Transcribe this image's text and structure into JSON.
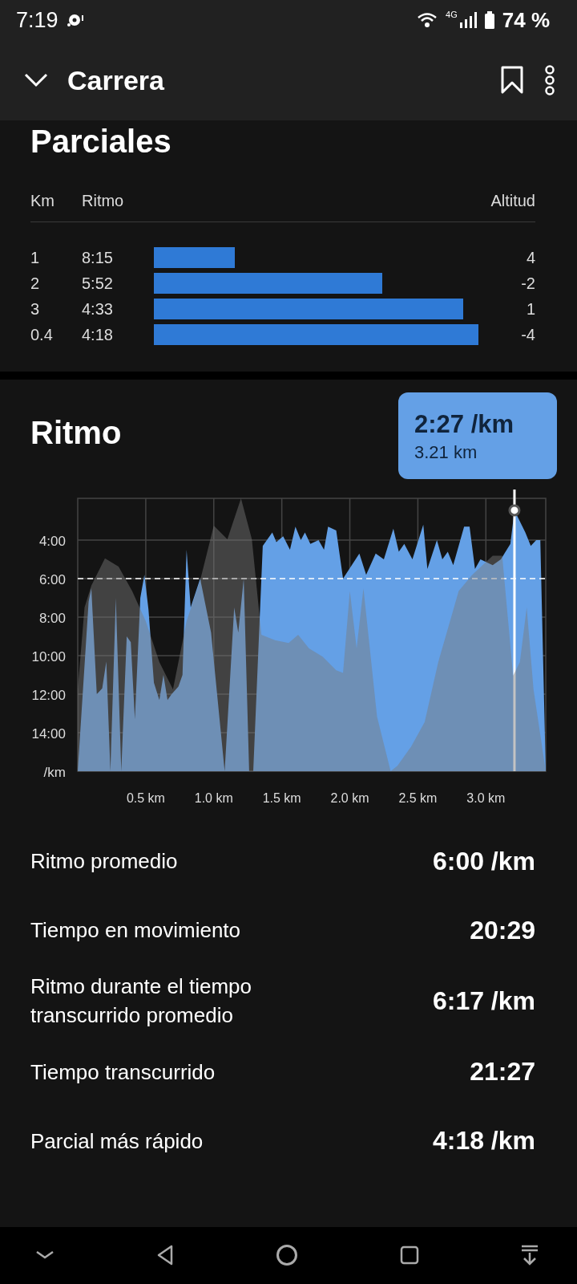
{
  "status_bar": {
    "time": "7:19",
    "network": "4G",
    "battery": "74 %"
  },
  "app_bar": {
    "title": "Carrera"
  },
  "splits": {
    "title": "Parciales",
    "columns": [
      "Km",
      "Ritmo",
      "Altitud"
    ],
    "rows": [
      {
        "km": "1",
        "pace": "8:15",
        "elevation": "4"
      },
      {
        "km": "2",
        "pace": "5:52",
        "elevation": "-2"
      },
      {
        "km": "3",
        "pace": "4:33",
        "elevation": "1"
      },
      {
        "km": "0.4",
        "pace": "4:18",
        "elevation": "-4"
      }
    ]
  },
  "pace": {
    "title": "Ritmo",
    "tooltip": {
      "value": "2:27 /km",
      "distance": "3.21 km"
    },
    "chart_data": {
      "type": "area",
      "grid": true,
      "xlim": [
        0,
        3.44
      ],
      "ylim": [
        16,
        1.83
      ],
      "x": [
        0,
        0.08,
        0.1,
        0.14,
        0.18,
        0.21,
        0.24,
        0.28,
        0.32,
        0.36,
        0.39,
        0.42,
        0.46,
        0.49,
        0.52,
        0.56,
        0.6,
        0.63,
        0.66,
        0.69,
        0.74,
        0.77,
        0.8,
        0.83,
        0.9,
        0.98,
        1.08,
        1.15,
        1.18,
        1.22,
        1.26,
        1.29,
        1.36,
        1.43,
        1.46,
        1.51,
        1.56,
        1.6,
        1.64,
        1.67,
        1.71,
        1.77,
        1.81,
        1.84,
        1.9,
        1.95,
        2.07,
        2.12,
        2.19,
        2.25,
        2.32,
        2.36,
        2.4,
        2.46,
        2.54,
        2.57,
        2.64,
        2.68,
        2.72,
        2.76,
        2.84,
        2.88,
        2.92,
        2.96,
        3.05,
        3.11,
        3.18,
        3.21,
        3.29,
        3.33,
        3.37,
        3.4,
        3.42,
        3.43,
        3.44
      ],
      "series": [
        {
          "color": "#64a0e6",
          "values": [
            16,
            7.2,
            6.5,
            12,
            11.7,
            10.3,
            16,
            7,
            16,
            9,
            9.3,
            13.3,
            7,
            5.8,
            7.6,
            11.4,
            12.3,
            11,
            12.3,
            12,
            11.6,
            11,
            4.5,
            7.5,
            6,
            8.8,
            16,
            7.5,
            8.8,
            6,
            16,
            16,
            4.3,
            3.6,
            4.1,
            3.8,
            4.5,
            3.3,
            4,
            3.6,
            4.2,
            4,
            4.5,
            3.3,
            3.5,
            6,
            4.7,
            5.8,
            4.7,
            5,
            3.4,
            4.6,
            4.2,
            5,
            3.2,
            5.5,
            4,
            5,
            4.6,
            5.3,
            3.3,
            3.3,
            5.5,
            5,
            5.3,
            5,
            4.2,
            2.45,
            3.6,
            4.3,
            4,
            4,
            10,
            13,
            16
          ]
        }
      ],
      "xticks": [
        {
          "value": 0.5,
          "label": "0.5 km"
        },
        {
          "value": 1.0,
          "label": "1.0 km"
        },
        {
          "value": 1.5,
          "label": "1.5 km"
        },
        {
          "value": 2.0,
          "label": "2.0 km"
        },
        {
          "value": 2.5,
          "label": "2.5 km"
        },
        {
          "value": 3.0,
          "label": "3.0 km"
        }
      ],
      "yticks": [
        {
          "value": 4,
          "label": "4:00"
        },
        {
          "value": 6,
          "label": "6:00"
        },
        {
          "value": 8,
          "label": "8:00"
        },
        {
          "value": 10,
          "label": "10:00"
        },
        {
          "value": 12,
          "label": "12:00"
        },
        {
          "value": 14,
          "label": "14:00"
        },
        {
          "value": 16,
          "label": "/km"
        }
      ],
      "ref_lines": [
        {
          "axis": "x",
          "value": 3.21
        },
        {
          "axis": "y",
          "value": 6
        }
      ]
    }
  },
  "stats": [
    {
      "label": "Ritmo promedio",
      "value": "6:00 /km"
    },
    {
      "label": "Tiempo en movimiento",
      "value": "20:29"
    },
    {
      "label": "Ritmo durante el tiempo transcurrido promedio",
      "value": "6:17 /km"
    },
    {
      "label": "Tiempo transcurrido",
      "value": "21:27"
    },
    {
      "label": "Parcial más rápido",
      "value": "4:18 /km"
    }
  ]
}
